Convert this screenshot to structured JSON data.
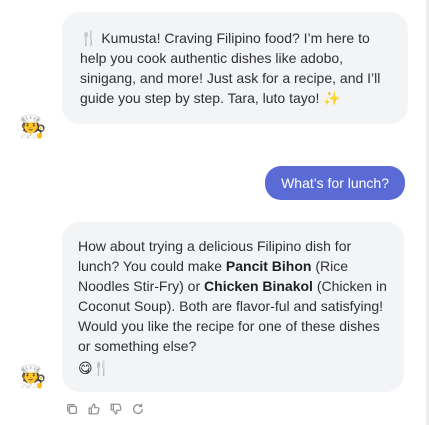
{
  "chat": {
    "bot_msg_1": {
      "lead_emoji": "🍴",
      "text": " Kumusta! Craving Filipino food? I’m here to help you cook authentic dishes like adobo, sinigang, and more! Just ask for a recipe, and I’ll guide you step by step. Tara, luto tayo! ",
      "tail_emoji": "✨"
    },
    "user_msg_1": {
      "text": "What’s for lunch?"
    },
    "bot_msg_2": {
      "part_1": "How about trying a delicious Filipino dish for lunch? You could make ",
      "bold_1": "Pancit Bihon",
      "part_2": " (Rice Noodles Stir-Fry) or ",
      "bold_2": "Chicken Binakol",
      "part_3": " (Chicken in Coconut Soup). Both are flavor-ful and satisfying! Would you like the recipe for one of these dishes or something else?",
      "emojis": "😋🍴"
    },
    "bot_avatar": "🧑‍🍳",
    "actions": [
      "copy-icon",
      "thumbs-up-icon",
      "thumbs-down-icon",
      "regenerate-icon"
    ]
  }
}
